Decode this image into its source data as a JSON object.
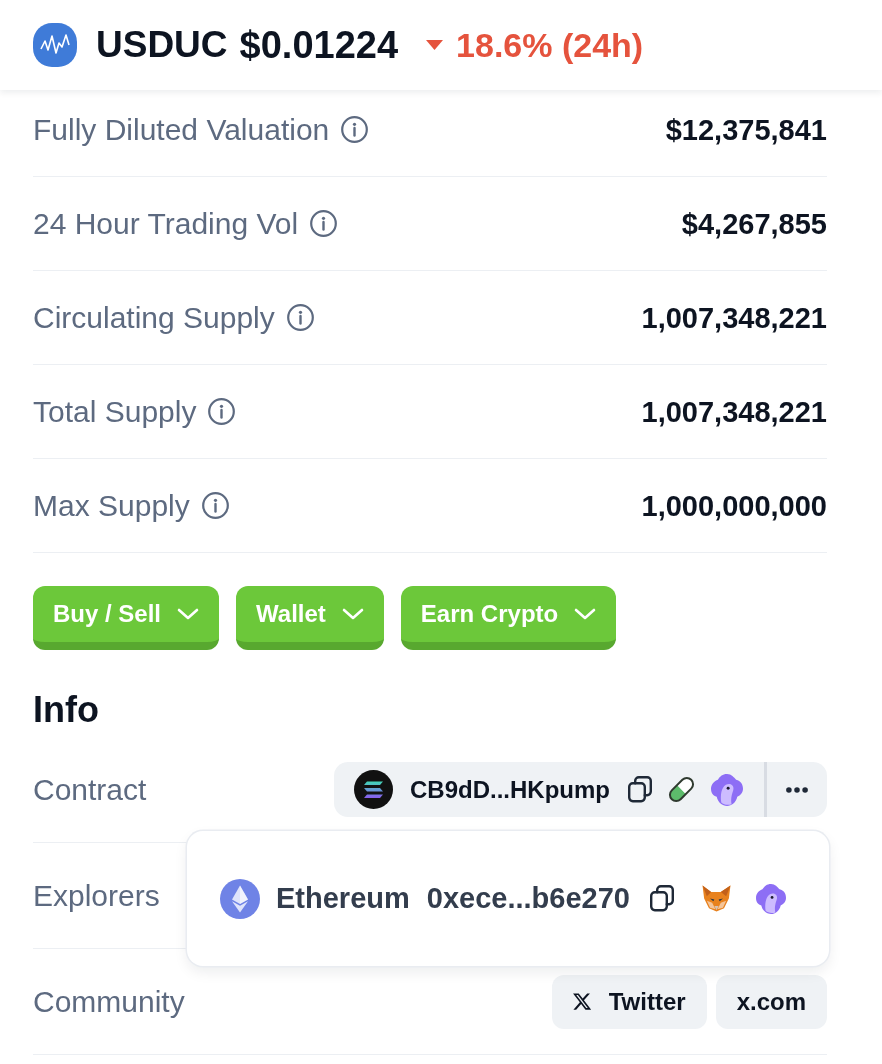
{
  "header": {
    "symbol": "USDUC",
    "price": "$0.01224",
    "change": {
      "falling": true,
      "text": "18.6% (24h)"
    }
  },
  "stats": [
    {
      "label": "Fully Diluted Valuation",
      "value": "$12,375,841"
    },
    {
      "label": "24 Hour Trading Vol",
      "value": "$4,267,855"
    },
    {
      "label": "Circulating Supply",
      "value": "1,007,348,221"
    },
    {
      "label": "Total Supply",
      "value": "1,007,348,221"
    },
    {
      "label": "Max Supply",
      "value": "1,000,000,000"
    }
  ],
  "actions": [
    {
      "label": "Buy / Sell"
    },
    {
      "label": "Wallet"
    },
    {
      "label": "Earn Crypto"
    }
  ],
  "info": {
    "title": "Info",
    "rows": [
      {
        "kind": "contract",
        "label": "Contract",
        "address": "CB9dD...HKpump"
      },
      {
        "kind": "explorers",
        "label": "Explorers"
      },
      {
        "kind": "community",
        "label": "Community",
        "links": [
          {
            "kind": "social",
            "label": "Twitter"
          },
          {
            "kind": "website",
            "label": "x.com"
          }
        ]
      }
    ]
  },
  "explorer_menu": {
    "network": "Ethereum",
    "address": "0xece...b6e270"
  }
}
